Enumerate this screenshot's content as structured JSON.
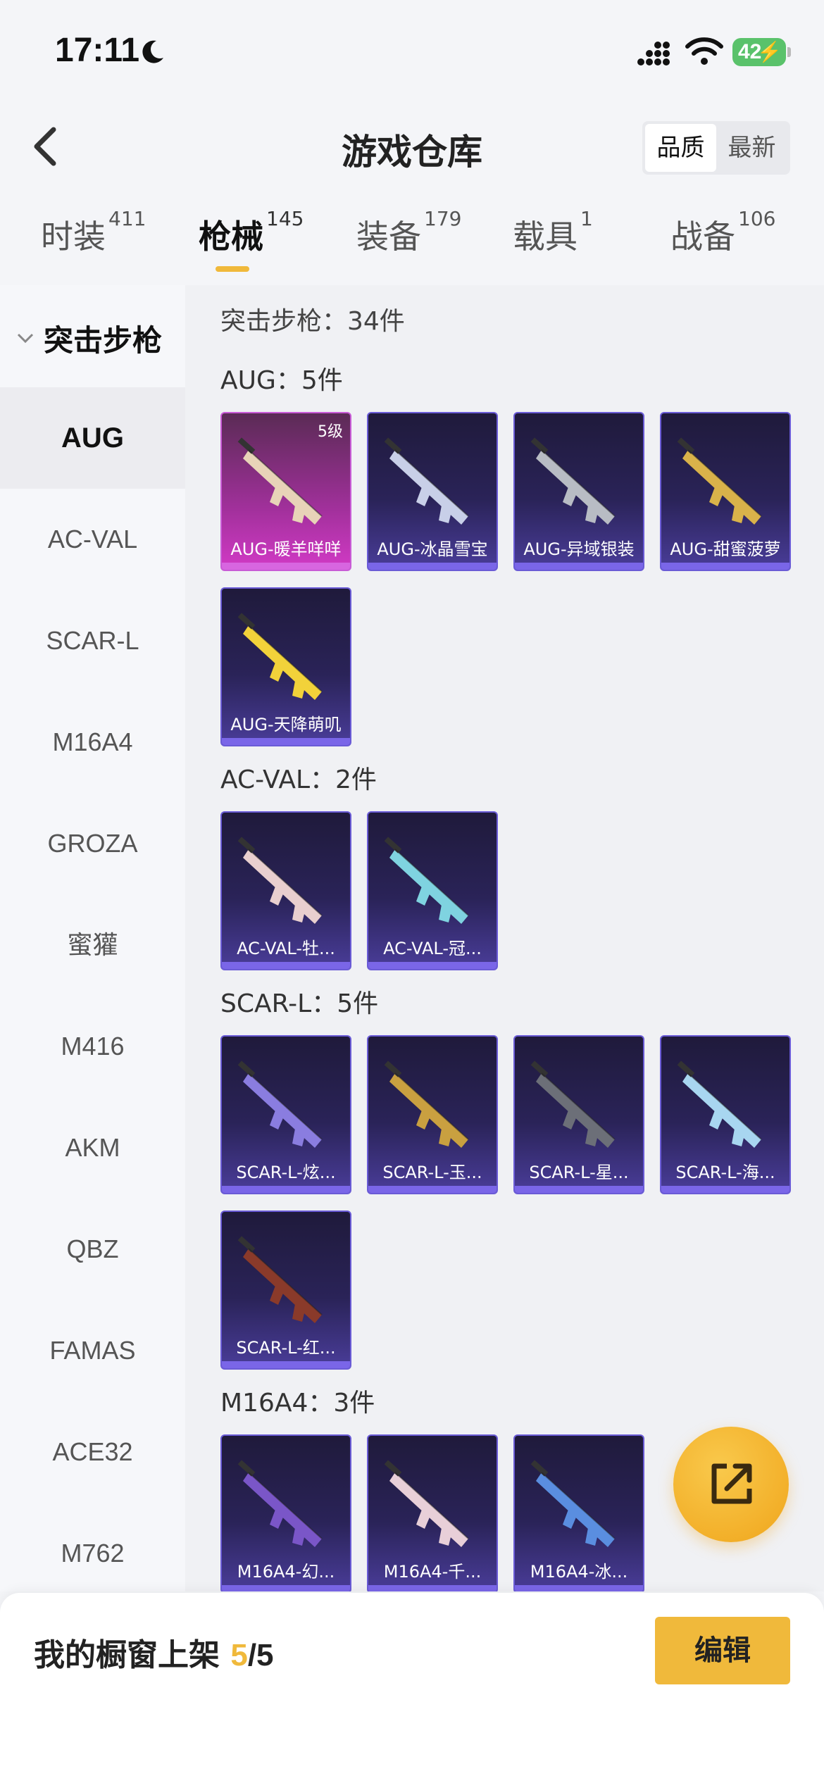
{
  "status": {
    "time": "17:11",
    "battery": "42"
  },
  "header": {
    "title": "游戏仓库",
    "sort_options": [
      "品质",
      "最新"
    ],
    "sort_selected": "品质"
  },
  "tabs": [
    {
      "label": "时装",
      "count": "411"
    },
    {
      "label": "枪械",
      "count": "145"
    },
    {
      "label": "装备",
      "count": "179"
    },
    {
      "label": "载具",
      "count": "1"
    },
    {
      "label": "战备",
      "count": "106"
    }
  ],
  "active_tab": "枪械",
  "sidebar": {
    "category": "突击步枪",
    "items": [
      "AUG",
      "AC-VAL",
      "SCAR-L",
      "M16A4",
      "GROZA",
      "蜜獾",
      "M416",
      "AKM",
      "QBZ",
      "FAMAS",
      "ACE32",
      "M762"
    ],
    "active": "AUG"
  },
  "content": {
    "summary": "突击步枪：34件",
    "groups": [
      {
        "title": "AUG：5件",
        "items": [
          {
            "label": "AUG-暖羊咩咩",
            "level": "5级",
            "tier": "gold",
            "color": "#e8d3b8"
          },
          {
            "label": "AUG-冰晶雪宝",
            "tier": "purple",
            "color": "#c8cfe8"
          },
          {
            "label": "AUG-异域银装",
            "tier": "purple",
            "color": "#b8bcc4"
          },
          {
            "label": "AUG-甜蜜菠萝",
            "tier": "purple",
            "color": "#d9b24a"
          },
          {
            "label": "AUG-天降萌叽",
            "tier": "purple",
            "color": "#f2d23a"
          }
        ]
      },
      {
        "title": "AC-VAL：2件",
        "items": [
          {
            "label": "AC-VAL-牡...",
            "tier": "purple",
            "color": "#e9cfcf"
          },
          {
            "label": "AC-VAL-冠...",
            "tier": "purple",
            "color": "#7fd3e0"
          }
        ]
      },
      {
        "title": "SCAR-L：5件",
        "items": [
          {
            "label": "SCAR-L-炫...",
            "tier": "purple",
            "color": "#8a7de0"
          },
          {
            "label": "SCAR-L-玉...",
            "tier": "purple",
            "color": "#c9a040"
          },
          {
            "label": "SCAR-L-星...",
            "tier": "purple",
            "color": "#6c6f78"
          },
          {
            "label": "SCAR-L-海...",
            "tier": "purple",
            "color": "#a8d6f0"
          },
          {
            "label": "SCAR-L-红...",
            "tier": "purple",
            "color": "#8a3a2a"
          }
        ]
      },
      {
        "title": "M16A4：3件",
        "items": [
          {
            "label": "M16A4-幻...",
            "tier": "purple",
            "color": "#7a56c8"
          },
          {
            "label": "M16A4-千...",
            "tier": "purple",
            "color": "#e8cfd8"
          },
          {
            "label": "M16A4-冰...",
            "tier": "purple",
            "color": "#5a8ee0"
          }
        ]
      }
    ]
  },
  "bottom": {
    "shelf_label": "我的橱窗上架",
    "current": "5",
    "total": "/5",
    "edit_label": "编辑"
  }
}
